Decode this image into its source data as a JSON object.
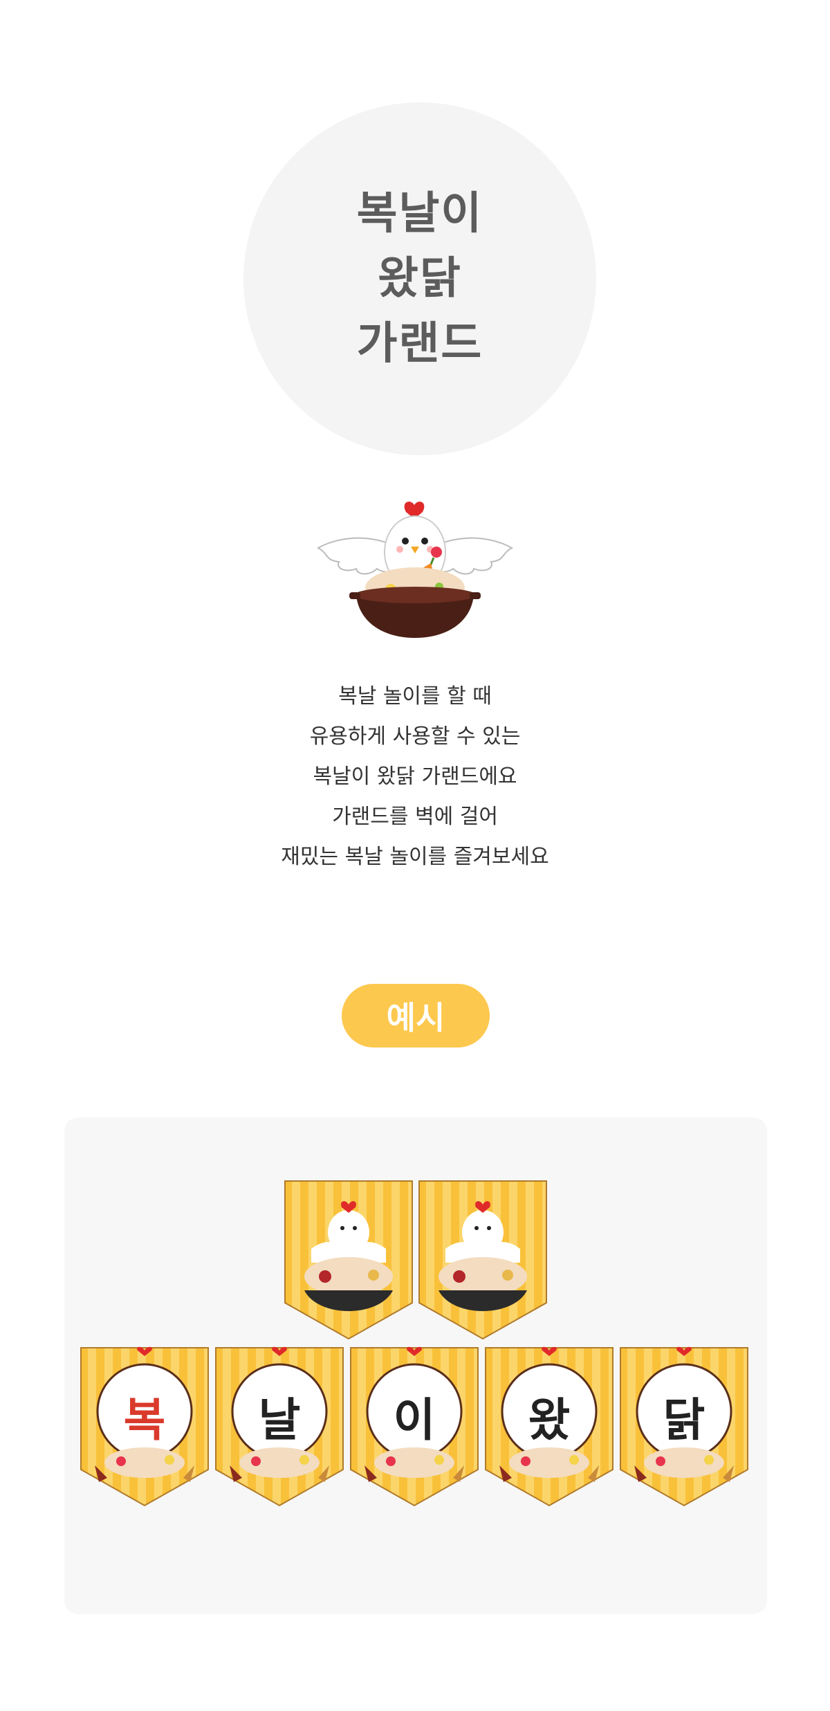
{
  "title": {
    "lines": [
      "복날이",
      "왔닭",
      "가랜드"
    ]
  },
  "description": {
    "lines": [
      "복날 놀이를 할 때",
      "유용하게 사용할 수 있는",
      "복날이 왔닭 가랜드에요",
      "가랜드를 벽에 걸어",
      "재밌는 복날 놀이를 즐겨보세요"
    ]
  },
  "example_label": "예시",
  "garland": {
    "letters": [
      "복",
      "날",
      "이",
      "왔",
      "닭"
    ],
    "letter_colors": [
      "#d93a2b",
      "#222222",
      "#222222",
      "#222222",
      "#222222"
    ]
  },
  "colors": {
    "accent": "#fdc84e",
    "title_text": "#5c5c5c",
    "circle_bg": "#f4f4f4",
    "panel_bg": "#f7f7f7"
  }
}
